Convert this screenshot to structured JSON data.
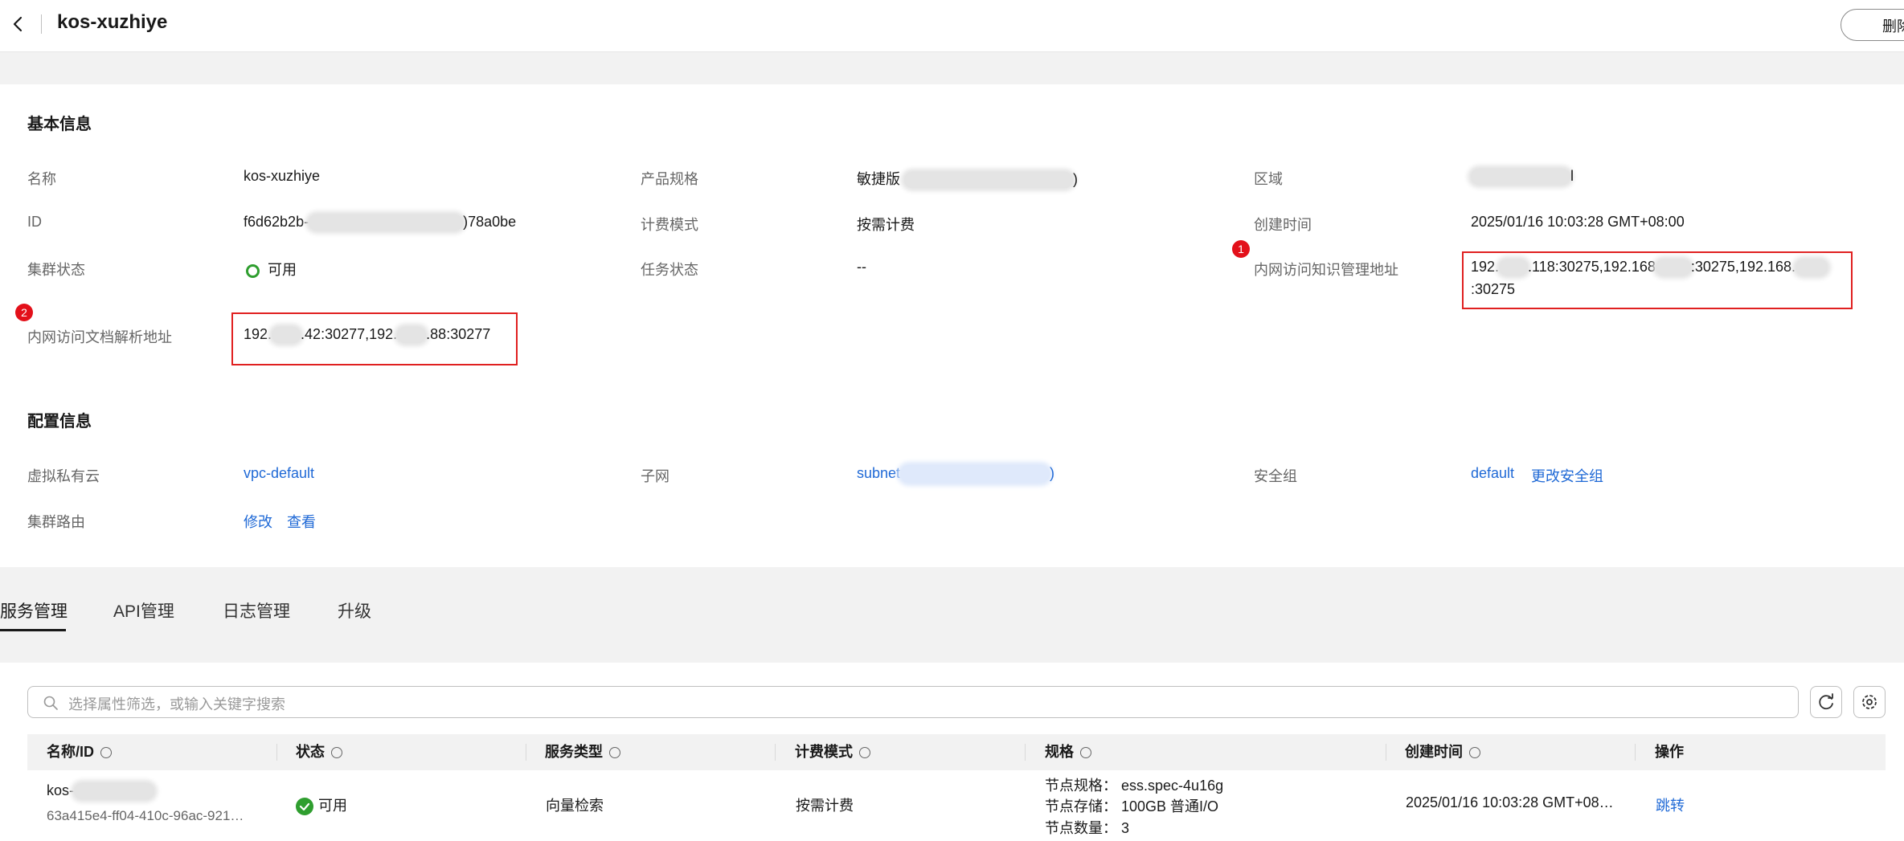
{
  "header": {
    "title": "kos-xuzhiye",
    "delete_label": "删除"
  },
  "basic_info": {
    "section_title": "基本信息",
    "name_label": "名称",
    "name_value": "kos-xuzhiye",
    "id_label": "ID",
    "id_prefix": "f6d62b2b-",
    "id_suffix": ")78a0be",
    "cluster_status_label": "集群状态",
    "cluster_status_value": "可用",
    "doc_parse_label": "内网访问文档解析地址",
    "doc_parse_part1": "192.",
    "doc_parse_part2": ".42:30277,192.",
    "doc_parse_part3": ".88:30277",
    "spec_label": "产品规格",
    "spec_value": "敏捷版",
    "spec_suffix": ")",
    "billing_label": "计费模式",
    "billing_value": "按需计费",
    "task_status_label": "任务状态",
    "task_status_value": "--",
    "region_label": "区域",
    "region_suffix": "l",
    "created_label": "创建时间",
    "created_value": "2025/01/16 10:03:28 GMT+08:00",
    "knowledge_label": "内网访问知识管理地址",
    "knowledge_part1": "192.",
    "knowledge_part2": ".118:30275,192.168",
    "knowledge_part3": ":30275,192.168.",
    "knowledge_line2": ":30275",
    "badge_1": "1",
    "badge_2": "2"
  },
  "config_info": {
    "section_title": "配置信息",
    "vpc_label": "虚拟私有云",
    "vpc_value": "vpc-default",
    "subnet_label": "子网",
    "subnet_value": "subnet",
    "subnet_suffix": ")",
    "sg_label": "安全组",
    "sg_value": "default",
    "sg_change": "更改安全组",
    "route_label": "集群路由",
    "route_modify": "修改",
    "route_view": "查看"
  },
  "tabs": [
    "服务管理",
    "API管理",
    "日志管理",
    "升级"
  ],
  "search": {
    "placeholder": "选择属性筛选，或输入关键字搜索"
  },
  "table": {
    "columns": [
      "名称/ID",
      "状态",
      "服务类型",
      "计费模式",
      "规格",
      "创建时间",
      "操作"
    ],
    "row": {
      "name": "kos-",
      "id": "63a415e4-ff04-410c-96ac-921…",
      "status": "可用",
      "service_type": "向量检索",
      "billing": "按需计费",
      "spec_node_label": "节点规格：",
      "spec_node_value": "ess.spec-4u16g",
      "spec_storage_label": "节点存储：",
      "spec_storage_value": "100GB 普通I/O",
      "spec_count_label": "节点数量：",
      "spec_count_value": "3",
      "created": "2025/01/16 10:03:28 GMT+08…",
      "action": "跳转"
    }
  },
  "colors": {
    "accent_link": "#1f69d6",
    "status_green": "#2f9e2f",
    "highlight_red": "#e02020"
  }
}
